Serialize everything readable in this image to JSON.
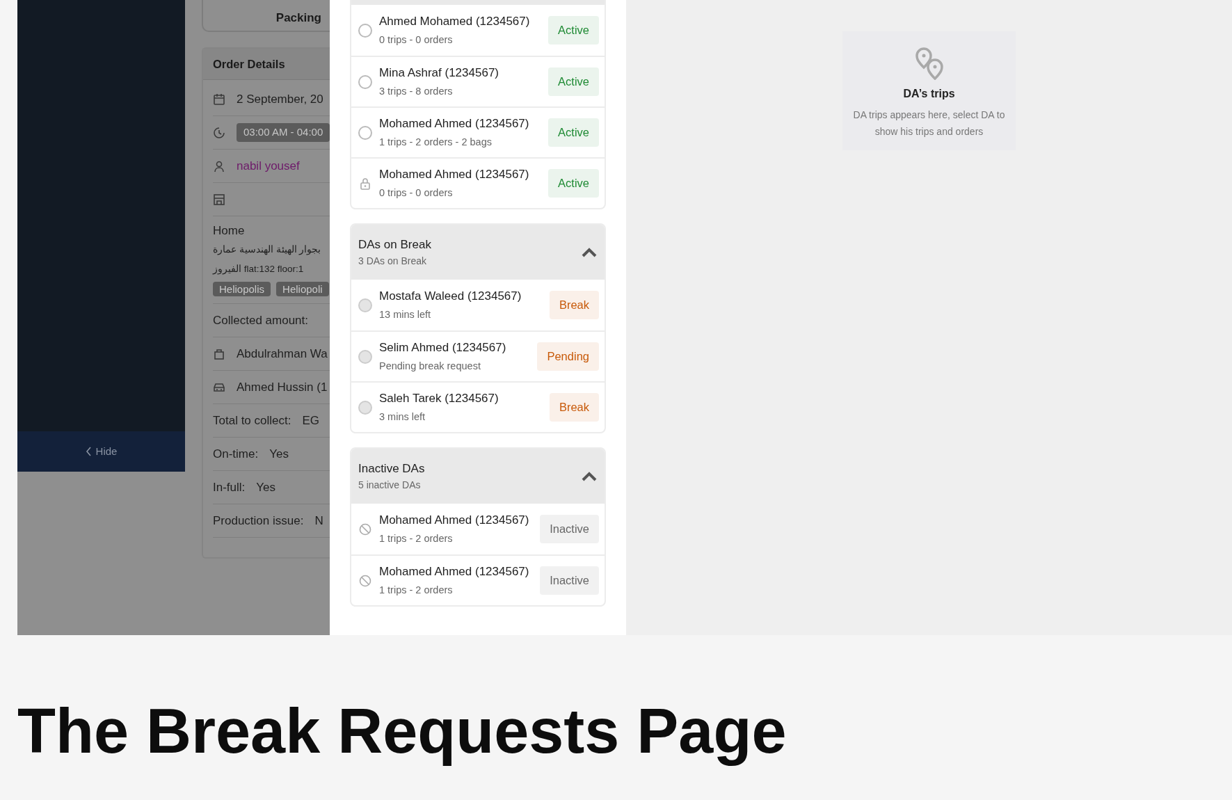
{
  "sidebar": {
    "hide_button": "Hide"
  },
  "order_panel": {
    "stage_card": "Packing",
    "title": "Order Details",
    "rows": [
      {
        "kind": "date",
        "text": "2 September, 20"
      },
      {
        "kind": "time",
        "badge": "03:00 AM - 04:00"
      },
      {
        "kind": "customer",
        "text": "nabil yousef"
      },
      {
        "kind": "store"
      },
      {
        "kind": "address",
        "label": "Home",
        "lines": [
          "بجوار الهيئة الهندسية عمارة",
          "الفيروز flat:132 floor:1"
        ],
        "tags": [
          "Heliopolis",
          "Heliopoli"
        ]
      },
      {
        "kind": "field",
        "label": "Collected amount:"
      },
      {
        "kind": "bag",
        "text": "Abdulrahman Wa"
      },
      {
        "kind": "car",
        "text": "Ahmed Hussin (1"
      },
      {
        "kind": "field",
        "label": "Total to collect:",
        "value": "EG"
      },
      {
        "kind": "field",
        "label": "On-time:",
        "value": "Yes"
      },
      {
        "kind": "field",
        "label": "In-full:",
        "value": "Yes"
      },
      {
        "kind": "field",
        "label": "Production issue:",
        "value": "N"
      }
    ]
  },
  "da_groups": [
    {
      "items": [
        {
          "kind": "radio",
          "selected": false,
          "name": "Ahmed Mohamed (1234567)",
          "detail": "0 trips - 0 orders",
          "status": "Active",
          "color": "#1e8a33"
        },
        {
          "kind": "radio",
          "selected": false,
          "name": "Mina Ashraf (1234567)",
          "detail": "3 trips - 8 orders",
          "status": "Active",
          "color": "#1e8a33"
        },
        {
          "kind": "radio",
          "selected": false,
          "name": "Mohamed Ahmed (1234567)",
          "detail": "1 trips - 2 orders - 2 bags",
          "status": "Active",
          "color": "#1e8a33"
        },
        {
          "kind": "locked",
          "selected": false,
          "name": "Mohamed Ahmed (1234567)",
          "detail": "0 trips - 0 orders",
          "status": "Active",
          "color": "#1e8a33"
        }
      ]
    },
    {
      "title": "DAs on Break",
      "subtitle": "3 DAs on Break",
      "expanded": true,
      "items": [
        {
          "kind": "radio-disabled",
          "selected": false,
          "name": "Mostafa Waleed (1234567)",
          "detail": "13 mins left",
          "status": "Break",
          "color": "#c85a0a"
        },
        {
          "kind": "radio-disabled",
          "selected": false,
          "name": "Selim Ahmed (1234567)",
          "detail": "Pending break request",
          "status": "Pending",
          "color": "#c85a0a"
        },
        {
          "kind": "radio-disabled",
          "selected": false,
          "name": "Saleh Tarek (1234567)",
          "detail": "3 mins left",
          "status": "Break",
          "color": "#c85a0a"
        }
      ]
    },
    {
      "title": "Inactive DAs",
      "subtitle": "5 inactive DAs",
      "expanded": true,
      "items": [
        {
          "kind": "blocked",
          "selected": false,
          "name": "Mohamed Ahmed (1234567)",
          "detail": "1 trips - 2 orders",
          "status": "Inactive",
          "color": "#666666"
        },
        {
          "kind": "blocked",
          "selected": false,
          "name": "Mohamed Ahmed (1234567)",
          "detail": "1 trips - 2 orders",
          "status": "Inactive",
          "color": "#666666"
        }
      ]
    }
  ],
  "trips_panel": {
    "title": "DA’s trips",
    "message": "DA trips appears here, select DA to show his trips and orders"
  },
  "page_heading": "The Break Requests Page"
}
